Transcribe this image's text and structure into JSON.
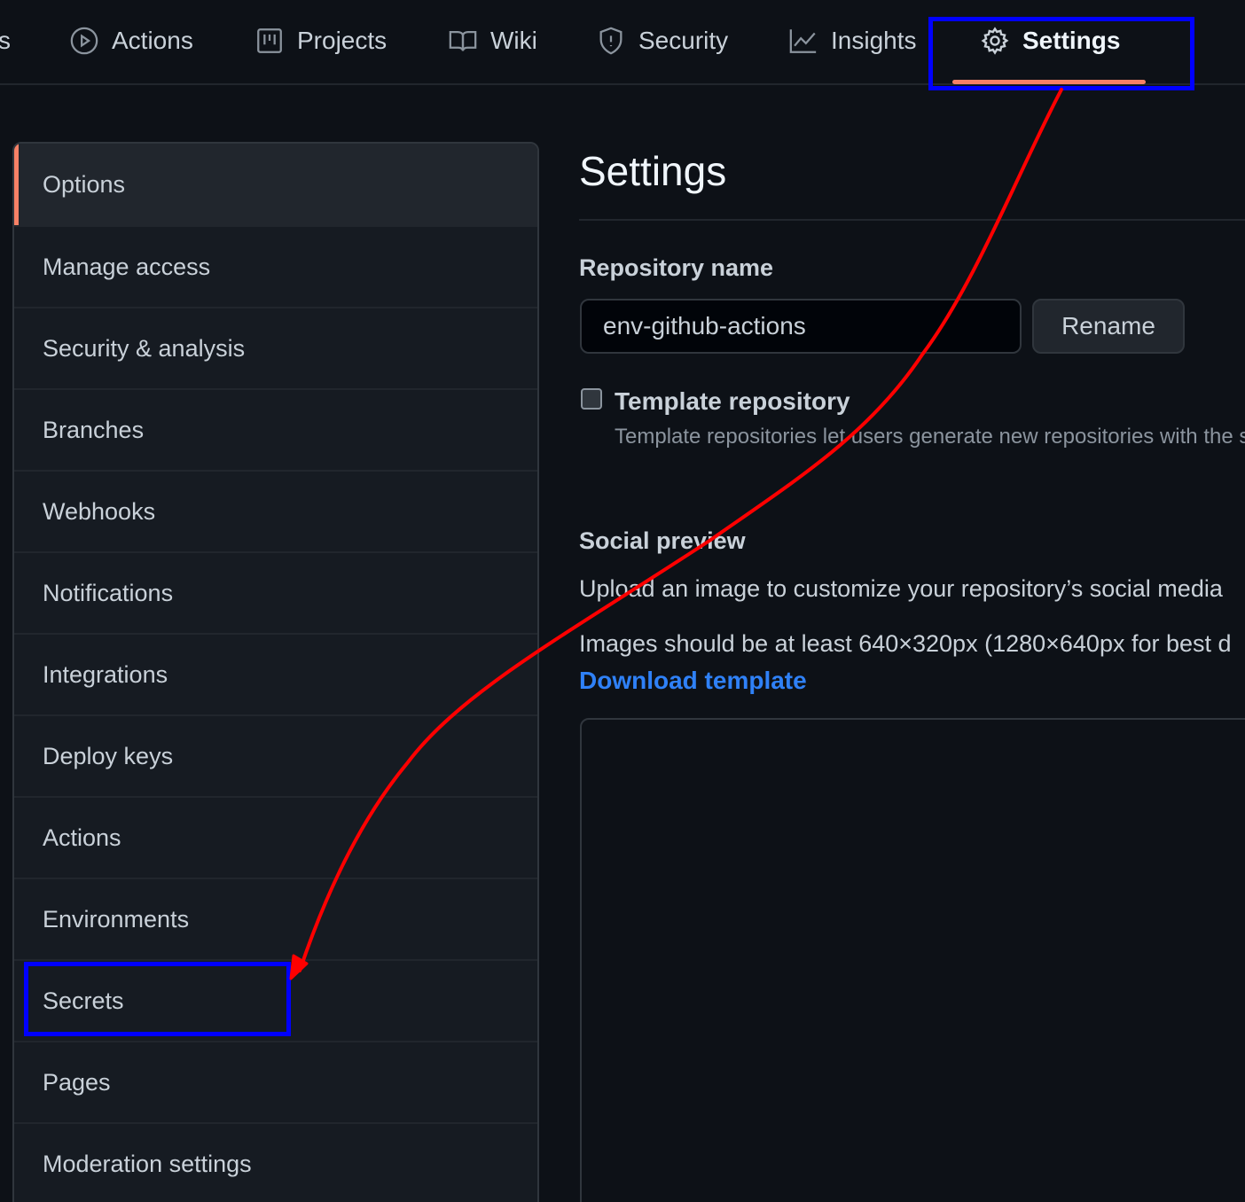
{
  "topnav": {
    "partial_tab": "s",
    "tabs": [
      {
        "label": "Actions",
        "icon": "play-icon"
      },
      {
        "label": "Projects",
        "icon": "project-board-icon"
      },
      {
        "label": "Wiki",
        "icon": "book-icon"
      },
      {
        "label": "Security",
        "icon": "shield-icon"
      },
      {
        "label": "Insights",
        "icon": "graph-icon"
      },
      {
        "label": "Settings",
        "icon": "gear-icon",
        "active": true
      }
    ]
  },
  "sidebar": {
    "items": [
      {
        "label": "Options",
        "selected": true
      },
      {
        "label": "Manage access"
      },
      {
        "label": "Security & analysis"
      },
      {
        "label": "Branches"
      },
      {
        "label": "Webhooks"
      },
      {
        "label": "Notifications"
      },
      {
        "label": "Integrations"
      },
      {
        "label": "Deploy keys"
      },
      {
        "label": "Actions"
      },
      {
        "label": "Environments"
      },
      {
        "label": "Secrets"
      },
      {
        "label": "Pages"
      },
      {
        "label": "Moderation settings"
      }
    ]
  },
  "main": {
    "title": "Settings",
    "repo_name_label": "Repository name",
    "repo_name_value": "env-github-actions",
    "rename_button": "Rename",
    "template_label": "Template repository",
    "template_checked": false,
    "template_desc": "Template repositories let users generate new repositories with the s",
    "social_preview_heading": "Social preview",
    "social_preview_desc": "Upload an image to customize your repository’s social media",
    "image_size_text": "Images should be at least 640×320px (1280×640px for best d",
    "download_template_link": "Download template"
  },
  "colors": {
    "background": "#0d1117",
    "sidebar_bg": "#161b22",
    "accent_underline": "#f78166",
    "link": "#2f81f7",
    "annotation_box": "#0000ff",
    "annotation_arrow": "#ff0000"
  }
}
